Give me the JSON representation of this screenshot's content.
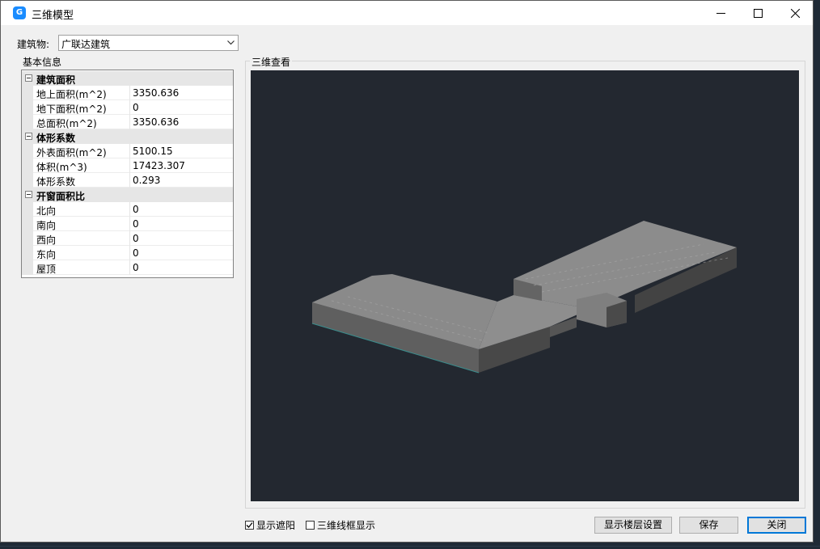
{
  "window": {
    "title": "三维模型",
    "icon": "app-logo-icon"
  },
  "building": {
    "label": "建筑物:",
    "selected": "广联达建筑"
  },
  "info_panel": {
    "title": "基本信息",
    "categories": [
      {
        "name": "建筑面积",
        "items": [
          {
            "key": "地上面积(m^2)",
            "value": "3350.636"
          },
          {
            "key": "地下面积(m^2)",
            "value": "0"
          },
          {
            "key": "总面积(m^2)",
            "value": "3350.636"
          }
        ]
      },
      {
        "name": "体形系数",
        "items": [
          {
            "key": "外表面积(m^2)",
            "value": "5100.15"
          },
          {
            "key": "体积(m^3)",
            "value": "17423.307"
          },
          {
            "key": "体形系数",
            "value": "0.293"
          }
        ]
      },
      {
        "name": "开窗面积比",
        "items": [
          {
            "key": "北向",
            "value": "0"
          },
          {
            "key": "南向",
            "value": "0"
          },
          {
            "key": "西向",
            "value": "0"
          },
          {
            "key": "东向",
            "value": "0"
          },
          {
            "key": "屋顶",
            "value": "0"
          }
        ]
      }
    ]
  },
  "viewer": {
    "title": "三维查看",
    "background": "#232830"
  },
  "options": {
    "show_shading": {
      "label": "显示遮阳",
      "checked": true
    },
    "wireframe": {
      "label": "三维线框显示",
      "checked": false
    }
  },
  "buttons": {
    "floor_settings": "显示楼层设置",
    "save": "保存",
    "close": "关闭"
  }
}
